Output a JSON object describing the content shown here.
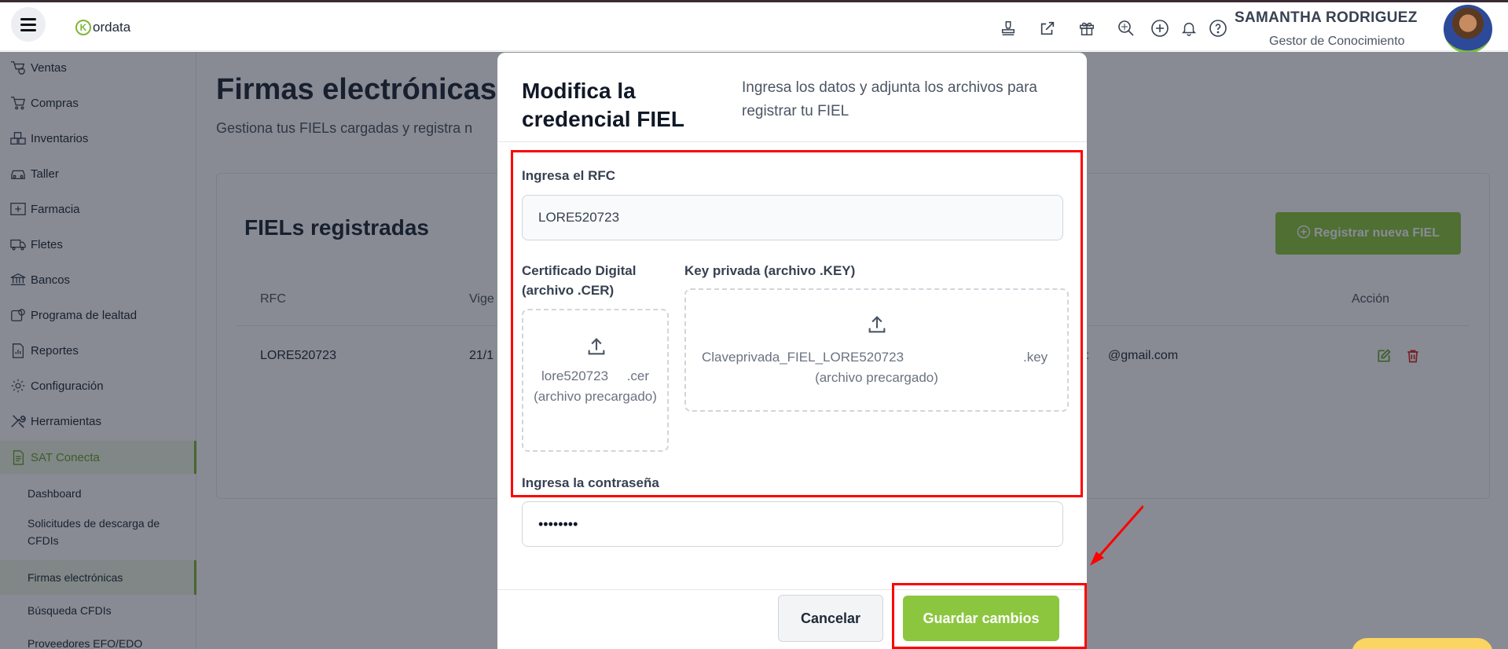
{
  "topbar": {
    "logo": "ordata",
    "logo_letter": "K",
    "user_name": "SAMANTHA RODRIGUEZ",
    "user_role": "Gestor de Conocimiento",
    "icons": [
      "stamp-icon",
      "external-link-icon",
      "gift-icon",
      "search-zoom-icon",
      "plus-circle-icon",
      "bell-icon",
      "help-icon"
    ]
  },
  "sidebar": {
    "items": [
      {
        "label": "Ventas",
        "icon": "sales-icon"
      },
      {
        "label": "Compras",
        "icon": "cart-icon"
      },
      {
        "label": "Inventarios",
        "icon": "boxes-icon"
      },
      {
        "label": "Taller",
        "icon": "car-icon"
      },
      {
        "label": "Farmacia",
        "icon": "pharmacy-icon"
      },
      {
        "label": "Fletes",
        "icon": "truck-icon"
      },
      {
        "label": "Bancos",
        "icon": "bank-icon"
      },
      {
        "label": "Programa de lealtad",
        "icon": "loyalty-icon"
      },
      {
        "label": "Reportes",
        "icon": "report-icon"
      },
      {
        "label": "Configuración",
        "icon": "gear-icon"
      },
      {
        "label": "Herramientas",
        "icon": "tools-icon"
      },
      {
        "label": "SAT Conecta",
        "icon": "document-icon"
      }
    ],
    "sub_items": [
      {
        "label": "Dashboard"
      },
      {
        "label": "Solicitudes de descarga de CFDIs"
      },
      {
        "label": "Firmas electrónicas"
      },
      {
        "label": "Búsqueda CFDIs"
      },
      {
        "label": "Proveedores EFO/EDO"
      }
    ]
  },
  "page": {
    "title": "Firmas electrónicas",
    "subtitle": "Gestiona tus FIELs cargadas y registra n",
    "card_title": "FIELs registradas",
    "register_button": "Registrar nueva FIEL",
    "table": {
      "headers": {
        "rfc": "RFC",
        "vigencia": "Vige",
        "accion": "Acción"
      },
      "row": {
        "rfc": "LORE520723",
        "vigencia": "21/1",
        "email_left": ":",
        "email": "@gmail.com"
      }
    }
  },
  "modal": {
    "title": "Modifica la credencial FIEL",
    "description": "Ingresa los datos y adjunta los archivos para registrar tu FIEL",
    "rfc_label": "Ingresa el RFC",
    "rfc_value": "LORE520723",
    "cer_label": "Certificado Digital (archivo .CER)",
    "cer_file_name": "lore520723",
    "cer_file_ext": ".cer",
    "cer_file_note": "(archivo precargado)",
    "key_label": "Key privada (archivo .KEY)",
    "key_file_name": "Claveprivada_FIEL_LORE520723",
    "key_file_ext": ".key",
    "key_file_note": "(archivo precargado)",
    "password_label": "Ingresa la contraseña",
    "password_value": "••••••••",
    "cancel_button": "Cancelar",
    "save_button": "Guardar cambios"
  },
  "colors": {
    "brand_green": "#8cc63f",
    "highlight_red": "#ff0000",
    "active_green_text": "#6aa22c"
  }
}
